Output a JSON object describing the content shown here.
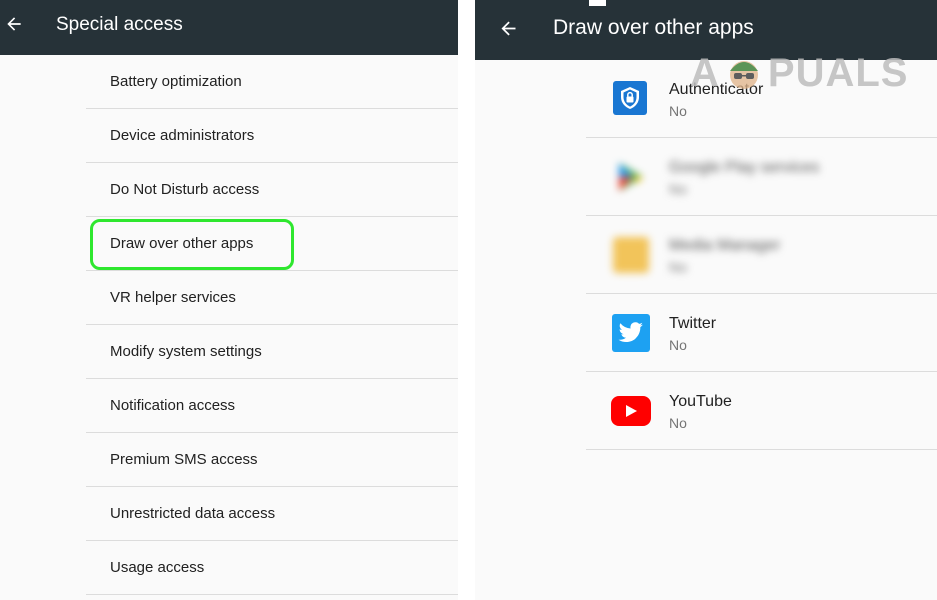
{
  "left_panel": {
    "title": "Special access",
    "back_icon": "arrow-left-icon",
    "items": [
      {
        "label": "Battery optimization"
      },
      {
        "label": "Device administrators"
      },
      {
        "label": "Do Not Disturb access"
      },
      {
        "label": "Draw over other apps"
      },
      {
        "label": "VR helper services"
      },
      {
        "label": "Modify system settings"
      },
      {
        "label": "Notification access"
      },
      {
        "label": "Premium SMS access"
      },
      {
        "label": "Unrestricted data access"
      },
      {
        "label": "Usage access"
      }
    ],
    "highlight_color": "#2ee72e"
  },
  "right_panel": {
    "title": "Draw over other apps",
    "back_icon": "arrow-left-icon",
    "apps": [
      {
        "name": "Authenticator",
        "status": "No",
        "icon": "authenticator-icon"
      },
      {
        "name": "Google Play services",
        "status": "No",
        "icon": "google-play-services-icon"
      },
      {
        "name": "Media Manager",
        "status": "No",
        "icon": "folder-icon"
      },
      {
        "name": "Twitter",
        "status": "No",
        "icon": "twitter-icon"
      },
      {
        "name": "YouTube",
        "status": "No",
        "icon": "youtube-icon"
      }
    ]
  },
  "watermark": {
    "text_a": "A",
    "text_rest": "PUALS"
  },
  "colors": {
    "toolbar": "#263238",
    "authenticator": "#1976d2",
    "twitter": "#1da1f2",
    "youtube": "#ff0000"
  }
}
